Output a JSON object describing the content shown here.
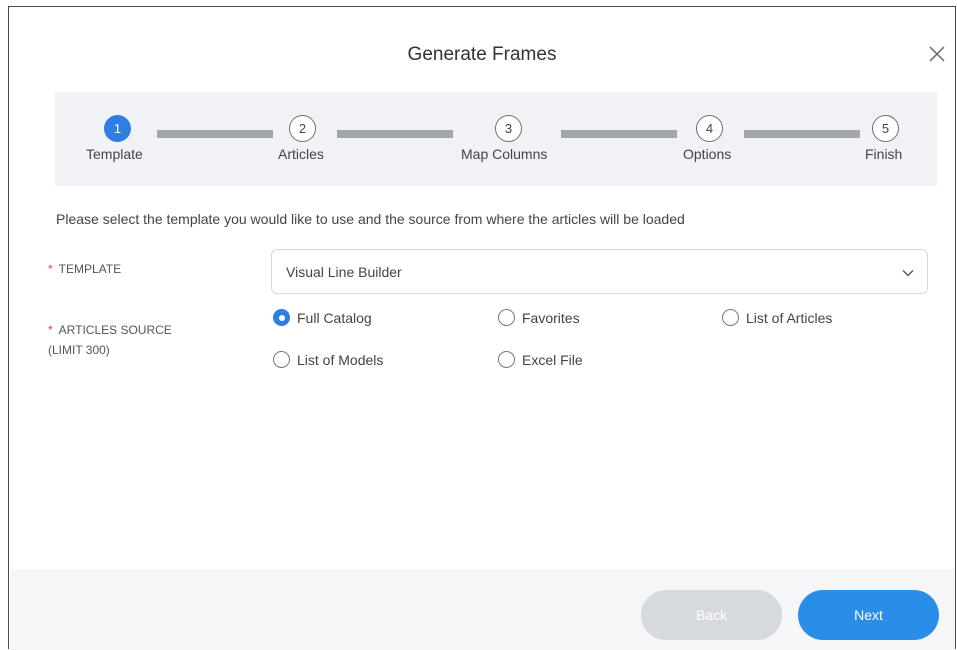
{
  "dialog": {
    "title": "Generate Frames",
    "close_icon": "close-icon"
  },
  "steps": [
    {
      "number": "1",
      "label": "Template",
      "active": true
    },
    {
      "number": "2",
      "label": "Articles",
      "active": false
    },
    {
      "number": "3",
      "label": "Map Columns",
      "active": false
    },
    {
      "number": "4",
      "label": "Options",
      "active": false
    },
    {
      "number": "5",
      "label": "Finish",
      "active": false
    }
  ],
  "intro_text": "Please select the template you would like to use and the source from where the articles will be loaded",
  "template_field": {
    "required_mark": "*",
    "label": "TEMPLATE",
    "value": "Visual Line Builder",
    "icon": "chevron-down-icon"
  },
  "articles_source": {
    "required_mark": "*",
    "label": "ARTICLES SOURCE",
    "sublabel": "(LIMIT 300)",
    "options": [
      {
        "label": "Full Catalog",
        "selected": true
      },
      {
        "label": "Favorites",
        "selected": false
      },
      {
        "label": "List of Articles",
        "selected": false
      },
      {
        "label": "List of Models",
        "selected": false
      },
      {
        "label": "Excel File",
        "selected": false
      }
    ]
  },
  "footer": {
    "back_label": "Back",
    "next_label": "Next"
  },
  "colors": {
    "accent": "#2f7ee6",
    "next_button": "#2a8ee8",
    "back_button_disabled": "#d6d9de",
    "required": "#e04040",
    "stepper_bg": "#f1f2f5"
  }
}
